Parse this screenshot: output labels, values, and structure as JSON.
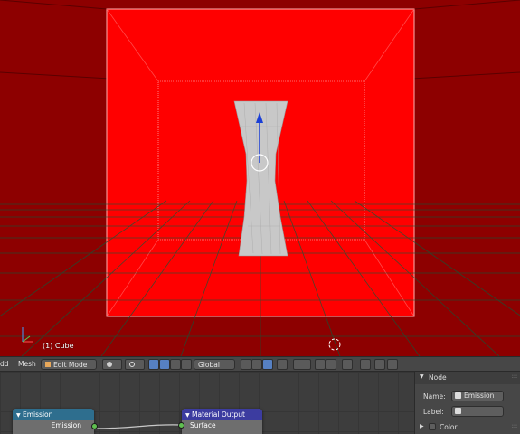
{
  "viewport": {
    "object_label": "(1) Cube",
    "colors": {
      "background": "#8d0000",
      "camera_frame": "#ff0000",
      "mesh": "#c8c8c8",
      "gizmo": "#1a3fd6"
    }
  },
  "header": {
    "add_menu": "dd",
    "mesh_menu": "Mesh",
    "mode_select": "Edit Mode",
    "orientation_select": "Global"
  },
  "node_editor": {
    "emission_node": {
      "title": "Emission",
      "output_socket": "Emission",
      "header_color": "#2e6e8e"
    },
    "output_node": {
      "title": "Material Output",
      "input_socket": "Surface",
      "header_color": "#3c3ca0"
    }
  },
  "properties": {
    "section_title": "Node",
    "name_label": "Name:",
    "name_value": "Emission",
    "label_label": "Label:",
    "label_value": "",
    "color_section": "Color"
  }
}
